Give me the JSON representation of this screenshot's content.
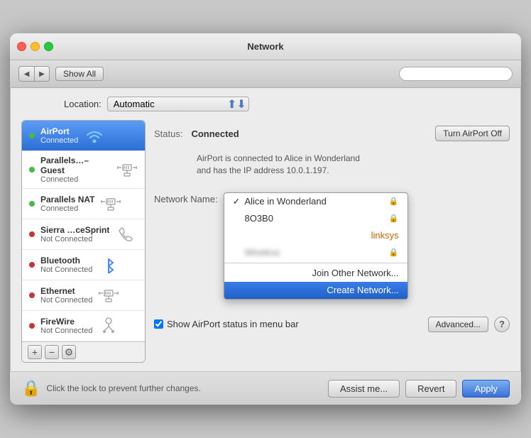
{
  "window": {
    "title": "Network"
  },
  "toolbar": {
    "back_label": "◀",
    "forward_label": "▶",
    "show_all_label": "Show All",
    "search_placeholder": ""
  },
  "location": {
    "label": "Location:",
    "value": "Automatic"
  },
  "sidebar": {
    "items": [
      {
        "id": "airport",
        "name": "AirPort",
        "status": "Connected",
        "dot": "green",
        "active": true,
        "icon": "wifi"
      },
      {
        "id": "parallels-guest",
        "name": "Parallels…–Guest",
        "status": "Connected",
        "dot": "green",
        "active": false,
        "icon": "ethernet"
      },
      {
        "id": "parallels-nat",
        "name": "Parallels NAT",
        "status": "Connected",
        "dot": "green",
        "active": false,
        "icon": "ethernet"
      },
      {
        "id": "sierra-cesprint",
        "name": "Sierra …ceSprint",
        "status": "Not Connected",
        "dot": "red",
        "active": false,
        "icon": "phone"
      },
      {
        "id": "bluetooth",
        "name": "Bluetooth",
        "status": "Not Connected",
        "dot": "red",
        "active": false,
        "icon": "bluetooth"
      },
      {
        "id": "ethernet",
        "name": "Ethernet",
        "status": "Not Connected",
        "dot": "red",
        "active": false,
        "icon": "ethernet"
      },
      {
        "id": "firewire",
        "name": "FireWire",
        "status": "Not Connected",
        "dot": "red",
        "active": false,
        "icon": "firewire"
      }
    ],
    "add_label": "+",
    "remove_label": "−",
    "settings_label": "⚙"
  },
  "detail": {
    "status_label": "Status:",
    "status_value": "Connected",
    "turn_off_label": "Turn AirPort Off",
    "description": "AirPort is connected to Alice in Wonderland\nand has the IP address 10.0.1.197.",
    "network_name_label": "Network Name:",
    "show_airport_label": "Show AirPort status in menu bar",
    "advanced_label": "Advanced...",
    "help_label": "?"
  },
  "dropdown": {
    "items": [
      {
        "label": "Alice in Wonderland",
        "checked": true,
        "locked": true,
        "style": "normal",
        "highlighted": false
      },
      {
        "label": "8O3B0",
        "checked": false,
        "locked": true,
        "style": "normal",
        "highlighted": false
      },
      {
        "label": "linksys",
        "checked": false,
        "locked": false,
        "style": "orange",
        "highlighted": false
      },
      {
        "label": "Wireless",
        "checked": false,
        "locked": true,
        "style": "blurred",
        "highlighted": false
      }
    ],
    "divider_after": 3,
    "extra_items": [
      {
        "label": "Join Other Network...",
        "highlighted": false
      },
      {
        "label": "Create Network...",
        "highlighted": true
      }
    ]
  },
  "bottom": {
    "lock_text": "Click the lock to prevent further changes.",
    "assist_label": "Assist me...",
    "revert_label": "Revert",
    "apply_label": "Apply"
  }
}
